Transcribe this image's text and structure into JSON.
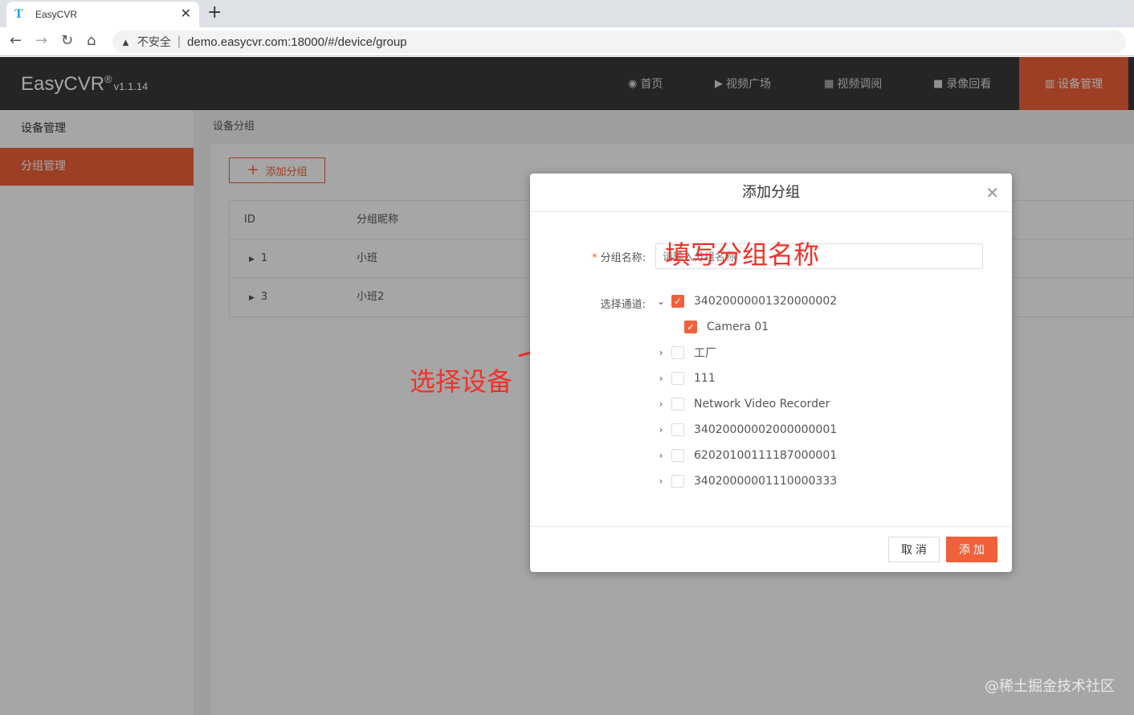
{
  "browser": {
    "tab_title": "EasyCVR",
    "tab_logo": "T",
    "insecure_label": "不安全",
    "url": "demo.easycvr.com:18000/#/device/group"
  },
  "app": {
    "brand": "EasyCVR",
    "brand_reg": "®",
    "version": "v1.1.14",
    "nav": [
      {
        "label": "首页",
        "icon": "dashboard-icon",
        "glyph": "◉"
      },
      {
        "label": "视频广场",
        "icon": "play-circle-icon",
        "glyph": "▶"
      },
      {
        "label": "视频调阅",
        "icon": "grid-view-icon",
        "glyph": "▦"
      },
      {
        "label": "录像回看",
        "icon": "video-camera-icon",
        "glyph": "■"
      },
      {
        "label": "设备管理",
        "icon": "device-list-icon",
        "glyph": "▥"
      }
    ],
    "accent_color": "#f0613a"
  },
  "sidebar": {
    "items": [
      {
        "label": "设备管理"
      },
      {
        "label": "分组管理"
      }
    ]
  },
  "content": {
    "breadcrumb": "设备分组",
    "add_button": "添加分组",
    "table": {
      "columns": [
        "ID",
        "分组昵称"
      ],
      "rows": [
        {
          "id": "1",
          "name": "小班"
        },
        {
          "id": "3",
          "name": "小班2"
        }
      ]
    }
  },
  "modal": {
    "title": "添加分组",
    "name_label": "分组名称:",
    "name_placeholder": "请输入分组名称",
    "channel_label": "选择通道:",
    "tree": [
      {
        "label": "34020000001320000002",
        "checked": true,
        "expanded": true
      },
      {
        "label": "Camera 01",
        "checked": true,
        "child": true
      },
      {
        "label": "工厂",
        "checked": false
      },
      {
        "label": "111",
        "checked": false
      },
      {
        "label": "Network Video Recorder",
        "checked": false
      },
      {
        "label": "34020000002000000001",
        "checked": false
      },
      {
        "label": "62020100111187000001",
        "checked": false
      },
      {
        "label": "34020000001110000333",
        "checked": false
      }
    ],
    "cancel_label": "取 消",
    "confirm_label": "添 加"
  },
  "annotations": {
    "fill_name": "填写分组名称",
    "select_device": "选择设备",
    "color": "#f0322a"
  },
  "watermark": "@稀土掘金技术社区"
}
